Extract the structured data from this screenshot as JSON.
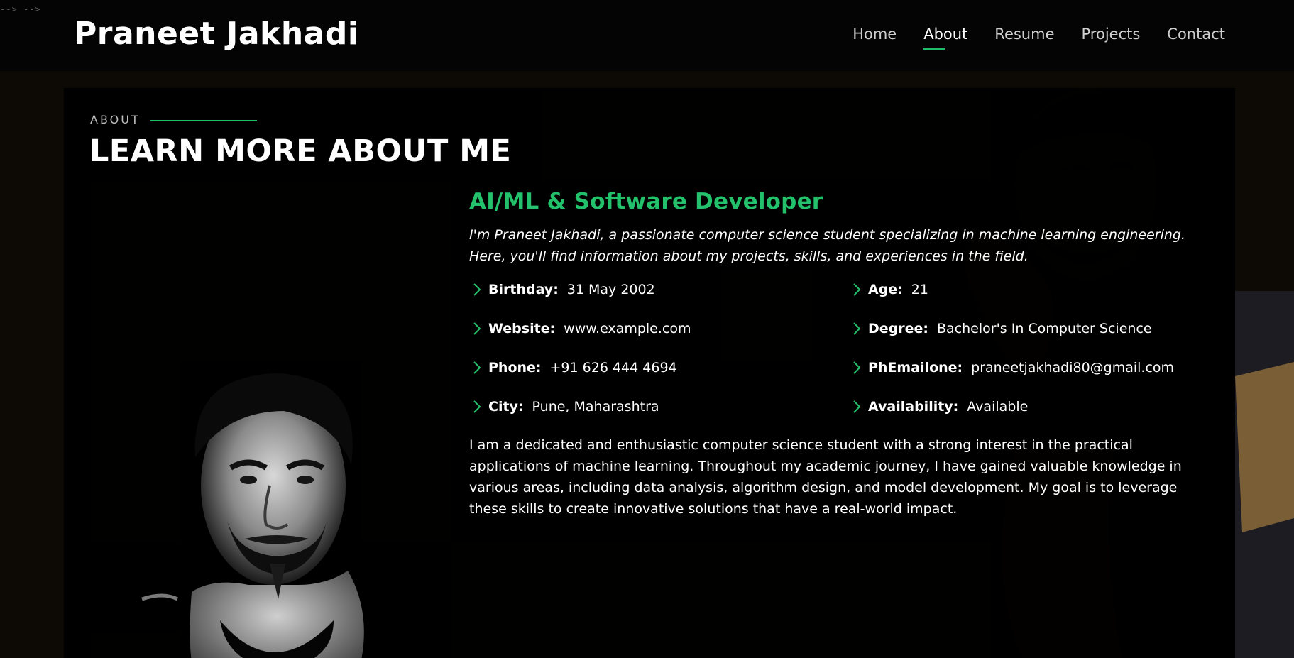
{
  "corner_text": "-->  -->",
  "header": {
    "logo": "Praneet Jakhadi",
    "nav": [
      {
        "label": "Home",
        "active": false
      },
      {
        "label": "About",
        "active": true
      },
      {
        "label": "Resume",
        "active": false
      },
      {
        "label": "Projects",
        "active": false
      },
      {
        "label": "Contact",
        "active": false
      }
    ]
  },
  "about": {
    "eyebrow": "ABOUT",
    "title": "LEARN MORE ABOUT ME",
    "role": "AI/ML & Software Developer",
    "intro": "I'm Praneet Jakhadi, a passionate computer science student specializing in machine learning engineering. Here, you'll find information about my projects, skills, and experiences in the field.",
    "facts": [
      {
        "label": "Birthday:",
        "value": "31 May 2002"
      },
      {
        "label": "Age:",
        "value": "21"
      },
      {
        "label": "Website:",
        "value": "www.example.com"
      },
      {
        "label": "Degree:",
        "value": "Bachelor's In Computer Science"
      },
      {
        "label": "Phone:",
        "value": "+91 626 444 4694"
      },
      {
        "label": "PhEmailone:",
        "value": "praneetjakhadi80@gmail.com"
      },
      {
        "label": "City:",
        "value": "Pune, Maharashtra"
      },
      {
        "label": "Availability:",
        "value": "Available"
      }
    ],
    "bio": "I am a dedicated and enthusiastic computer science student with a strong interest in the practical applications of machine learning. Throughout my academic journey, I have gained valuable knowledge in various areas, including data analysis, algorithm design, and model development. My goal is to leverage these skills to create innovative solutions that have a real-world impact."
  },
  "colors": {
    "accent": "#23c16b",
    "background": "#000000",
    "text": "#ffffff"
  },
  "icons": {
    "fact_bullet": "chevron-right-icon"
  }
}
